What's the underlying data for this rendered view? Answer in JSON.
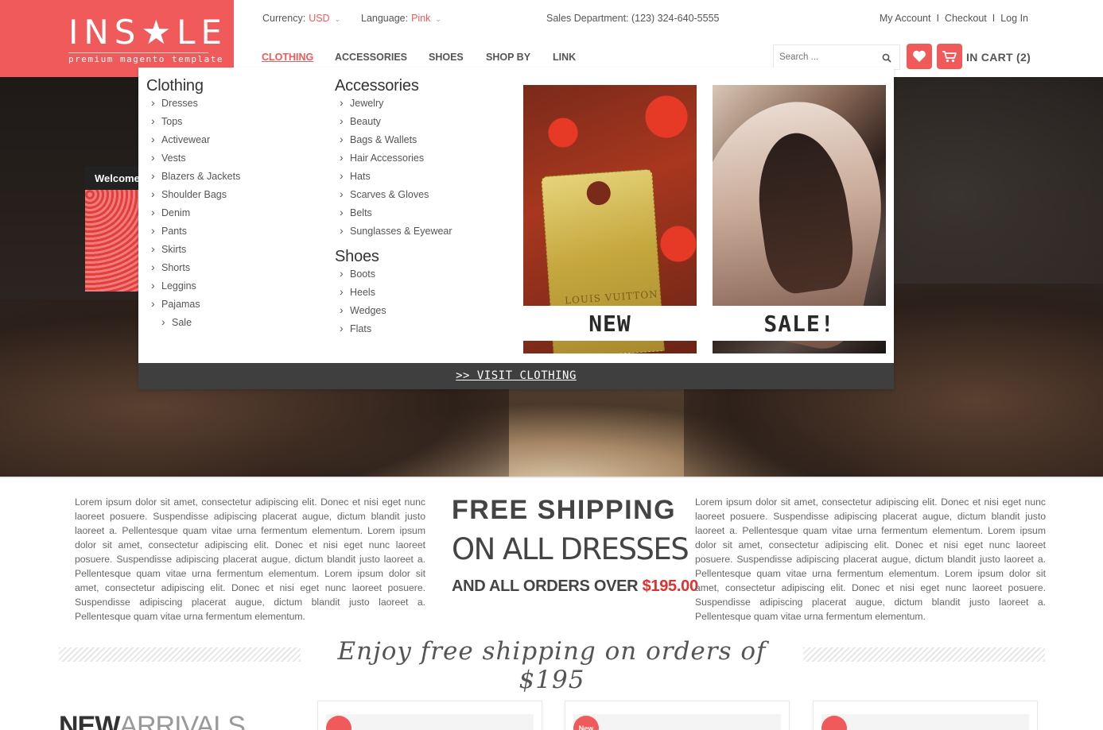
{
  "brand": {
    "logo_text": "INS★LE",
    "tagline": "premium magento template",
    "accent_color": "#f05a5a"
  },
  "topbar": {
    "currency_label": "Currency:",
    "currency_value": "USD",
    "language_label": "Language:",
    "language_value": "Pink",
    "sales_dept": "Sales Department: (123) 324-640-5555",
    "account_links": [
      "My Account",
      "Checkout",
      "Log In"
    ]
  },
  "nav": {
    "items": [
      "CLOTHING",
      "ACCESSORIES",
      "SHOES",
      "SHOP BY",
      "LINK"
    ],
    "active": "CLOTHING"
  },
  "search": {
    "placeholder": "Search ..."
  },
  "cart": {
    "label": "IN CART (2)",
    "wishlist_icon": "heart-icon",
    "cart_icon": "cart-icon"
  },
  "hero": {
    "welcome_text": "Welcome"
  },
  "mega_menu": {
    "clothing": {
      "title": "Clothing",
      "items": [
        "Dresses",
        "Tops",
        "Activewear",
        "Vests",
        "Blazers & Jackets",
        "Shoulder Bags",
        "Denim",
        "Pants",
        "Skirts",
        "Shorts",
        "Leggins",
        "Pajamas"
      ],
      "sub_items": [
        "Sale"
      ]
    },
    "accessories": {
      "title": "Accessories",
      "items": [
        "Jewelry",
        "Beauty",
        "Bags & Wallets",
        "Hair Accessories",
        "Hats",
        "Scarves & Gloves",
        "Belts",
        "Sunglasses & Eyewear"
      ]
    },
    "shoes": {
      "title": "Shoes",
      "items": [
        "Boots",
        "Heels",
        "Wedges",
        "Flats"
      ]
    },
    "promo_new": {
      "label": "NEW",
      "tag_text": "LOUIS VUITTON"
    },
    "promo_sale": {
      "label": "SALE!"
    },
    "footer_link": ">> VISIT CLOTHING"
  },
  "content": {
    "lorem_left": "Lorem ipsum dolor sit amet, consectetur adipiscing elit. Donec et nisi eget nunc laoreet posuere. Suspendisse adipiscing placerat augue, dictum blandit justo laoreet a. Pellentesque quam vitae urna fermentum elementum. Lorem ipsum dolor sit amet, consectetur adipiscing elit. Donec et nisi eget nunc laoreet posuere. Suspendisse adipiscing placerat augue, dictum blandit justo laoreet a. Pellentesque quam vitae urna fermentum elementum. Lorem ipsum dolor sit amet, consectetur adipiscing elit. Donec et nisi eget nunc laoreet posuere. Suspendisse adipiscing placerat augue, dictum blandit justo laoreet a. Pellentesque quam vitae urna fermentum elementum.",
    "lorem_right": "Lorem ipsum dolor sit amet, consectetur adipiscing elit. Donec et nisi eget nunc laoreet posuere. Suspendisse adipiscing placerat augue, dictum blandit justo laoreet a. Pellentesque quam vitae urna fermentum elementum. Lorem ipsum dolor sit amet, consectetur adipiscing elit. Donec et nisi eget nunc laoreet posuere. Suspendisse adipiscing placerat augue, dictum blandit justo laoreet a. Pellentesque quam vitae urna fermentum elementum. Lorem ipsum dolor sit amet, consectetur adipiscing elit. Donec et nisi eget nunc laoreet posuere. Suspendisse adipiscing placerat augue, dictum blandit justo laoreet a. Pellentesque quam vitae urna fermentum elementum.",
    "shipping_line1": "FREE SHIPPING",
    "shipping_line2": "ON ALL DRESSES",
    "shipping_line3_prefix": "AND ALL ORDERS OVER ",
    "shipping_line3_price": "$195.00",
    "enjoy_banner": "Enjoy free shipping on orders of $195",
    "new_arrivals_bold": "NEW",
    "new_arrivals_light": "ARRIVALS",
    "product_badges": [
      "",
      "New",
      ""
    ]
  }
}
